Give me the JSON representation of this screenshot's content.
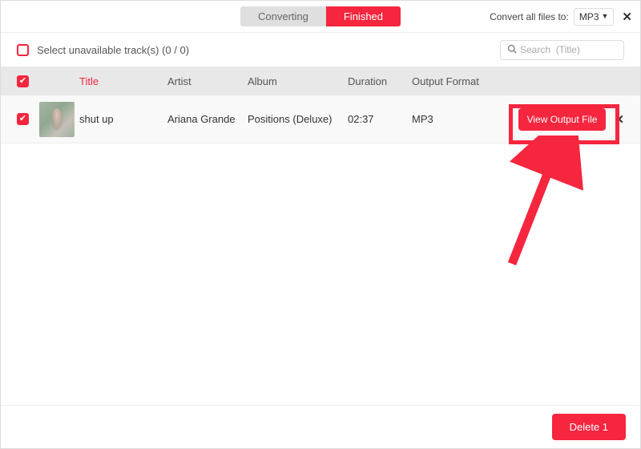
{
  "tabs": {
    "converting": "Converting",
    "finished": "Finished"
  },
  "topbar": {
    "convert_all_label": "Convert all files to:",
    "format_selected": "MP3"
  },
  "secondbar": {
    "select_unavailable": "Select unavailable track(s) (0 / 0)"
  },
  "search": {
    "placeholder": "Search  (Title)"
  },
  "columns": {
    "title": "Title",
    "artist": "Artist",
    "album": "Album",
    "duration": "Duration",
    "output_format": "Output Format"
  },
  "tracks": [
    {
      "title": "shut up",
      "artist": "Ariana Grande",
      "album": "Positions (Deluxe)",
      "duration": "02:37",
      "format": "MP3",
      "view_label": "View Output File"
    }
  ],
  "footer": {
    "delete_label": "Delete 1"
  },
  "colors": {
    "accent": "#f5263e"
  }
}
